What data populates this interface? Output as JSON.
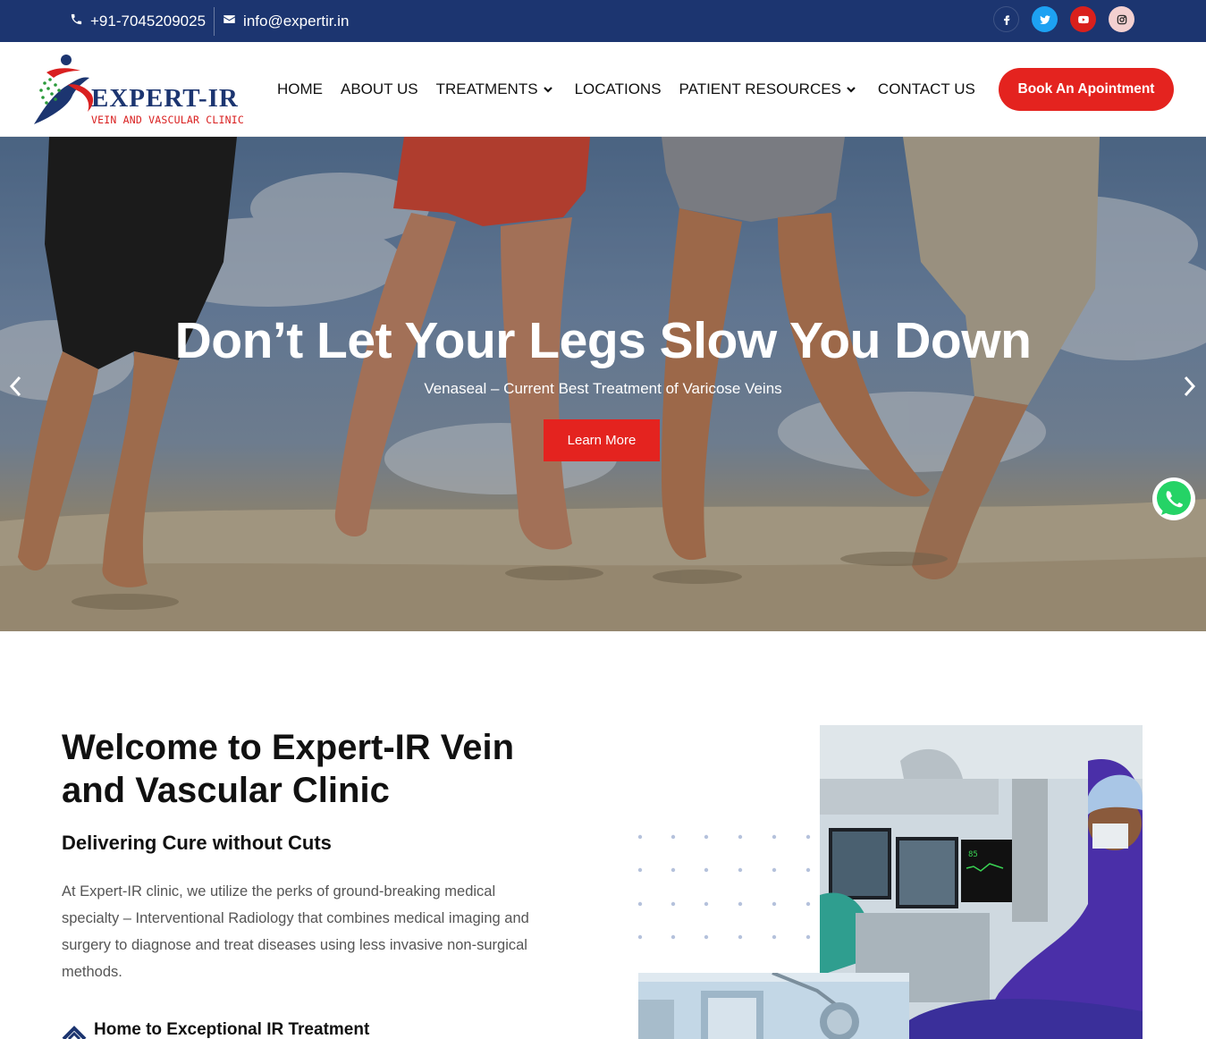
{
  "topbar": {
    "phone": "+91-7045209025",
    "email": "info@expertir.in",
    "socials": [
      {
        "icon": "facebook-icon",
        "color": "#1c3570"
      },
      {
        "icon": "twitter-icon",
        "color": "#1da1f2"
      },
      {
        "icon": "youtube-icon",
        "color": "#d9201c"
      },
      {
        "icon": "instagram-icon",
        "color": "#f3d0d0"
      }
    ]
  },
  "header": {
    "logo_name": "EXPERT-IR",
    "logo_sub": "VEIN AND VASCULAR CLINIC",
    "nav": [
      {
        "label": "HOME",
        "dropdown": false
      },
      {
        "label": "ABOUT US",
        "dropdown": false
      },
      {
        "label": "TREATMENTS",
        "dropdown": true
      },
      {
        "label": "LOCATIONS",
        "dropdown": false
      },
      {
        "label": "PATIENT RESOURCES",
        "dropdown": true
      },
      {
        "label": "CONTACT US",
        "dropdown": false
      }
    ],
    "cta": "Book An Apointment"
  },
  "hero": {
    "title": "Don’t Let Your Legs Slow You Down",
    "subtitle": "Venaseal – Current Best Treatment of Varicose Veins",
    "button": "Learn More"
  },
  "about": {
    "title": "Welcome to Expert-IR Vein and Vascular Clinic",
    "tagline": "Delivering Cure without Cuts",
    "body": "At Expert-IR clinic, we utilize the perks of ground-breaking medical specialty – Interventional Radiology that combines medical imaging and surgery to diagnose and treat diseases using less invasive non-surgical methods.",
    "feature": "Home to Exceptional IR Treatment"
  },
  "colors": {
    "brand_navy": "#1c3570",
    "brand_red": "#e4231f"
  }
}
